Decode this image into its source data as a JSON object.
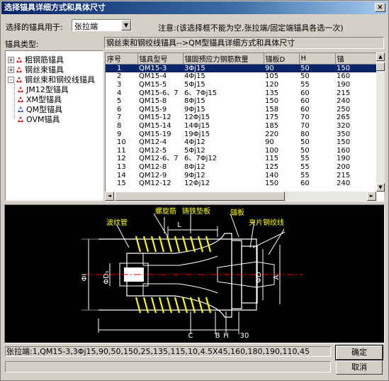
{
  "window": {
    "title": "选择锚具详细方式和具体尺寸",
    "close": "×"
  },
  "selector": {
    "label": "选择的锚具用于:",
    "value": "张拉端",
    "note": "注意:(该选择框不能为空,张拉端/固定端锚具各选一次)"
  },
  "tree": {
    "header": "锚具类型:",
    "items": [
      {
        "label": "粗钢筋锚具",
        "expander": "+",
        "icon_color": "#d40000"
      },
      {
        "label": "钢丝束锚具",
        "expander": "+",
        "icon_color": "#d40000"
      },
      {
        "label": "钢丝束和钢绞线锚具",
        "expander": "-",
        "icon_color": "#d40000"
      },
      {
        "label": "JM12型锚具",
        "icon_color": "#d40000"
      },
      {
        "label": "XM型锚具",
        "icon_color": "#d40000"
      },
      {
        "label": "QM型锚具",
        "icon_color": "#2040c0"
      },
      {
        "label": "OVM锚具",
        "icon_color": "#d40000"
      }
    ]
  },
  "grid": {
    "header_text": "钢丝束和钢绞线锚具-->QM型锚具详细方式和具体尺寸",
    "columns": [
      "序号",
      "锚具型号",
      "锚固预应力钢筋数量",
      "锚板D",
      "H",
      "锚"
    ],
    "rows": [
      [
        "1",
        "QM15-3",
        "3Φj15",
        "90",
        "50",
        "150"
      ],
      [
        "2",
        "QM15-4",
        "4Φj15",
        "105",
        "50",
        "160"
      ],
      [
        "3",
        "QM15-5",
        "5Φj15",
        "120",
        "55",
        "190"
      ],
      [
        "4",
        "QM15-6、7",
        "6、7Φj15",
        "135",
        "60",
        "215"
      ],
      [
        "5",
        "QM15-8",
        "8Φj15",
        "150",
        "60",
        "240"
      ],
      [
        "6",
        "QM15-9",
        "9Φj15",
        "158",
        "60",
        "250"
      ],
      [
        "7",
        "QM15-12",
        "12Φj15",
        "175",
        "70",
        "265"
      ],
      [
        "8",
        "QM15-14",
        "14Φj15",
        "185",
        "70",
        "320"
      ],
      [
        "9",
        "QM15-19",
        "19Φj15",
        "220",
        "80",
        "350"
      ],
      [
        "10",
        "QM12-4",
        "4Φj12",
        "90",
        "50",
        "150"
      ],
      [
        "11",
        "QM12-5",
        "5Φj12",
        "100",
        "50",
        "160"
      ],
      [
        "12",
        "QM12-6、7",
        "6、7Φj12",
        "115",
        "55",
        "190"
      ],
      [
        "13",
        "QM12-8",
        "8Φj12",
        "125",
        "55",
        "200"
      ],
      [
        "14",
        "QM12-9",
        "9Φj12",
        "140",
        "55",
        "215"
      ],
      [
        "15",
        "QM12-12",
        "12Φj12",
        "150",
        "60",
        "240"
      ]
    ],
    "selected_index": 0
  },
  "drawing": {
    "labels": {
      "corrugated": "波纹管",
      "spiral": "螺旋筋",
      "cast_plate": "铸铁垫板",
      "anchor_plate": "锚板",
      "clip": "夹片钢绞线",
      "L": "L",
      "C": "C",
      "B": "B",
      "H": "H",
      "dim30": "30",
      "phiI": "ΦI",
      "phiD1": "ΦD₁",
      "phiD": "ΦD",
      "A": "A"
    },
    "colors": {
      "line": "#ffffff",
      "spiral": "#ffff00",
      "label": "#ffff00",
      "center": "#ff0000"
    }
  },
  "result": {
    "text": "张拉端:1,QM15-3,3Φj15,90,50,150,25,135,115,10,4.5X45,160,180,190,110,45"
  },
  "buttons": {
    "ok": "确定",
    "cancel": "取消"
  },
  "scroll": {
    "up": "▲",
    "down": "▼",
    "left": "◄",
    "right": "►"
  },
  "combo_arrow": "▼"
}
